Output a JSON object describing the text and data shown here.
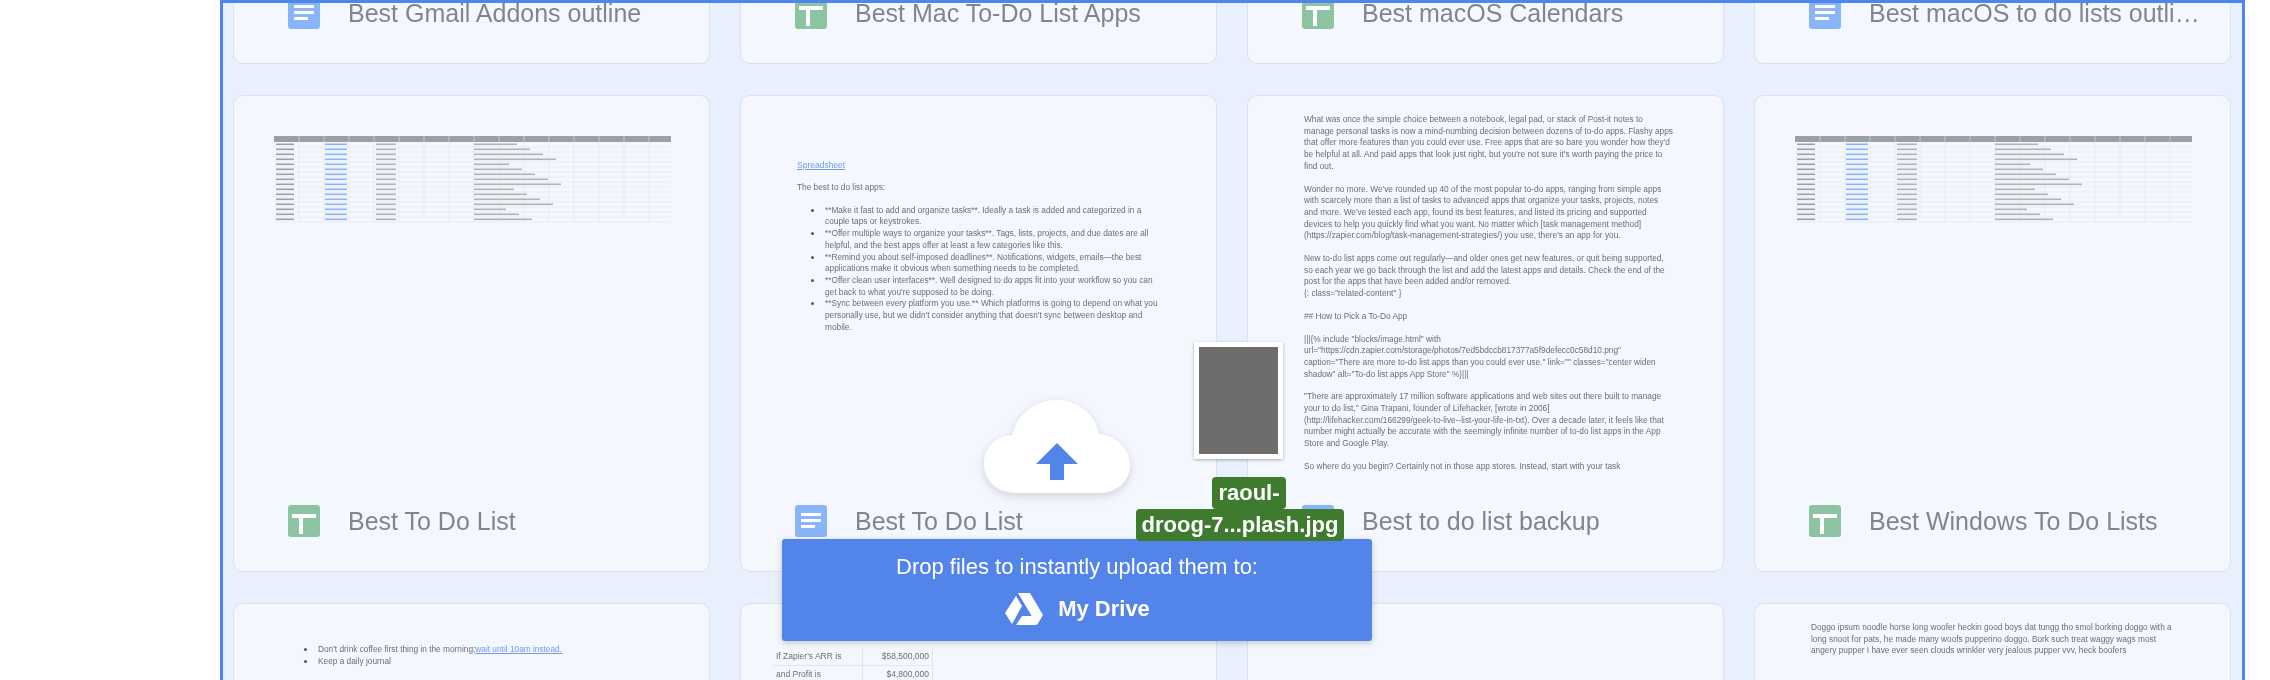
{
  "rows": [
    {
      "cards": [
        {
          "title": "Best Gmail Addons outline",
          "kind": "doc"
        },
        {
          "title": "Best Mac To-Do List Apps",
          "kind": "sheet"
        },
        {
          "title": "Best macOS Calendars",
          "kind": "sheet"
        },
        {
          "title": "Best macOS to do lists outli…",
          "kind": "doc"
        }
      ]
    },
    {
      "cards": [
        {
          "title": "Best To Do List",
          "kind": "sheet",
          "preview": {
            "kind": "sheet"
          }
        },
        {
          "title": "Best To Do List",
          "kind": "doc",
          "preview": {
            "kind": "doc",
            "link": "Spreadsheet",
            "intro": "The best to do list apps:",
            "bullets": [
              {
                "text": "**Make it fast to add and organize tasks**. Ideally a task is added and categorized in a couple taps or keystrokes."
              },
              {
                "text": "**Offer multiple ways to organize your tasks**. Tags, lists, projects, and due dates are all helpful, and the best apps offer at least a few categories like this."
              },
              {
                "text": "**Remind you about self-imposed deadlines**. Notifications, widgets, emails—the best applications make it obvious when something needs to be completed."
              },
              {
                "text": "**Offer clean user interfaces**. Well designed to do apps fit into your workflow so you can get back to what you're supposed to be doing."
              },
              {
                "text": "**Sync between every platform you use.** Which platforms is going to depend on what you personally use, but we didn't consider anything that doesn't sync between desktop and mobile."
              }
            ]
          }
        },
        {
          "title": "Best to do list backup",
          "kind": "doc",
          "preview": {
            "kind": "article",
            "paragraphs": [
              "What was once the simple choice between a notebook, legal pad, or stack of Post-it notes to manage personal tasks is now a mind-numbing decision between dozens of to-do apps. Flashy apps that offer more features than you could ever use. Free apps that are so bare you wonder how they'd be helpful at all. And paid apps that look just right, but you're not sure it's worth paying the price to find out.",
              "Wonder no more. We've rounded up 40 of the most popular to-do apps, ranging from simple apps with scarcely more than a list of tasks to advanced apps that organize your tasks, projects, notes and more. We've tested each app, found its best features, and listed its pricing and supported devices to help you quickly find what you want. No matter which [task management method](https://zapier.com/blog/task-management-strategies/) you use, there's an app for you.",
              "New to-do list apps come out regularly—and older ones get new features, or quit being supported, so each year we go back through the list and add the latest apps and details. Check the end of the post for the apps that have been added and/or removed.\n{: class=\"related-content\" }",
              "## How to Pick a To-Do App",
              "|||{% include \"blocks/image.html\" with url=\"https://cdn.zapier.com/storage/photos/7ed5bdccb817377a5f9defecc0c58d10.png\" caption=\"There are more to-do list apps than you could ever use.\" link=\"\" classes=\"center widen shadow\" alt=\"To-do list apps App Store\" %}|||",
              "\"There are approximately 17 million software applications and web sites out there built to manage your to do list,\" Gina Trapani, founder of Lifehacker, [wrote in 2006](http://lifehacker.com/166299/geek-to-live--list-your-life-in-txt). Over a decade later, it feels like that number might actually be accurate with the seemingly infinite number of to-do list apps in the App Store and Google Play.",
              "So where do you begin? Certainly not in those app stores. Instead, start with your task"
            ]
          }
        },
        {
          "title": "Best Windows To Do Lists",
          "kind": "sheet",
          "preview": {
            "kind": "sheet"
          }
        }
      ]
    },
    {
      "cards": [
        {
          "preview": {
            "kind": "doc",
            "bullets": [
              {
                "text": "Don't drink coffee first thing in the morning;",
                "link": "wait until 10am instead."
              },
              {
                "text": "Keep a daily journal"
              }
            ]
          }
        },
        {
          "preview": {
            "kind": "cells",
            "rows": [
              [
                "If Zapier's ARR is",
                "$58,500,000"
              ],
              [
                "and Profit is",
                "$4,800,000"
              ]
            ]
          }
        },
        {
          "preview": {
            "kind": "blank"
          }
        },
        {
          "preview": {
            "kind": "article",
            "paragraphs": [
              "Doggo ipsum noodle horse long woofer heckin good boys dat tungg tho smol borking doggo with a long snoot for pats, he made many woofs pupperino doggo.  Bork such treat waggy wags most angery pupper I have ever seen clouds wrinkler very jealous pupper vvv, heck boofers"
            ]
          }
        }
      ]
    }
  ],
  "upload": {
    "message": "Drop files to instantly upload them to:",
    "destination": "My Drive",
    "file_name_lines": [
      "raoul-",
      "droog-7...plash.jpg"
    ]
  }
}
